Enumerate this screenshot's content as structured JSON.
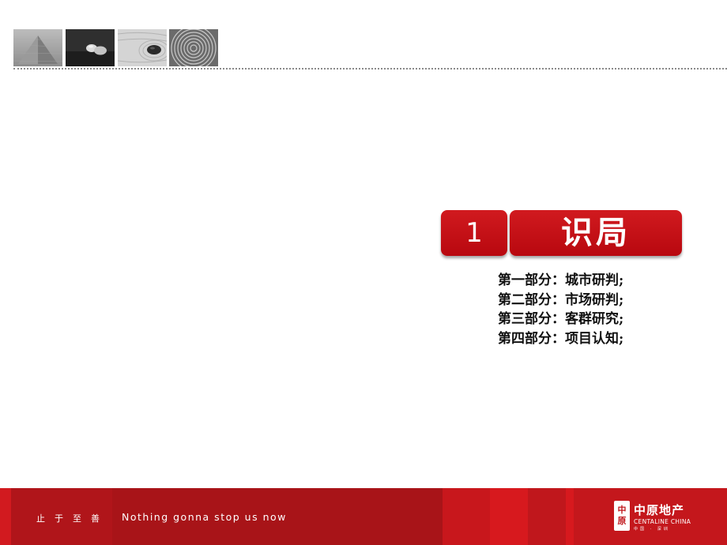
{
  "header": {
    "thumbnails": [
      "sand-pyramid-image",
      "pebbles-image",
      "raked-sand-stone-image",
      "tree-rings-image"
    ]
  },
  "chapter": {
    "number": "1",
    "title": "识局"
  },
  "toc": [
    "第一部分：城市研判;",
    "第二部分：市场研判;",
    "第三部分：客群研究;",
    "第四部分：项目认知;"
  ],
  "footer": {
    "slogan_cn": "止于至善",
    "slogan_en": "Nothing gonna stop us now",
    "logo": {
      "mark_top": "中",
      "mark_bottom": "原",
      "name_cn": "中原地产",
      "name_en": "CENTALINE CHINA",
      "sub": "中国 · 深圳"
    },
    "colors": {
      "base": "#c0171c",
      "dark": "#a81418",
      "bright": "#d7191e"
    }
  }
}
